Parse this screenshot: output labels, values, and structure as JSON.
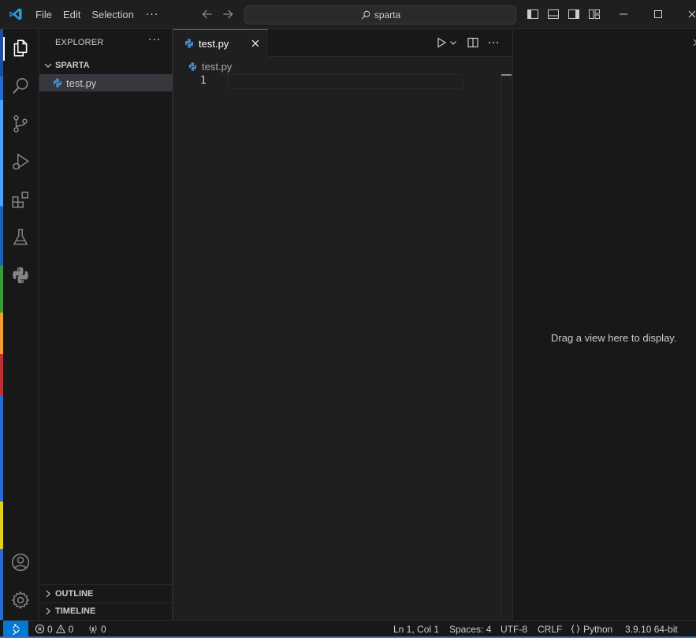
{
  "titlebar": {
    "menu": [
      "File",
      "Edit",
      "Selection"
    ],
    "more": "···",
    "search_text": "sparta"
  },
  "sidebar": {
    "title": "EXPLORER",
    "more": "···",
    "folder": "SPARTA",
    "files": [
      "test.py"
    ],
    "outline": "OUTLINE",
    "timeline": "TIMELINE"
  },
  "editor": {
    "tab_label": "test.py",
    "breadcrumb": "test.py",
    "line_number": "1"
  },
  "aux_panel": {
    "message": "Drag a view here to display."
  },
  "statusbar": {
    "errors": "0",
    "warnings": "0",
    "ports": "0",
    "position": "Ln 1, Col 1",
    "spaces": "Spaces: 4",
    "encoding": "UTF-8",
    "eol": "CRLF",
    "language": "Python",
    "interpreter": "3.9.10 64-bit"
  },
  "colors": {
    "accent": "#0078d4",
    "background": "#1f1f1f",
    "sidebar": "#181818",
    "selection": "#37373d",
    "python_icon": "#4a8fd1"
  },
  "icons": [
    "vscode-logo-icon",
    "arrow-left-icon",
    "arrow-right-icon",
    "search-icon",
    "toggle-sidebar-icon",
    "toggle-panel-icon",
    "toggle-secondary-sidebar-icon",
    "customize-layout-icon",
    "minimize-icon",
    "maximize-icon",
    "close-icon",
    "files-icon",
    "search-icon",
    "source-control-icon",
    "run-debug-icon",
    "extensions-icon",
    "testing-icon",
    "python-icon",
    "account-icon",
    "settings-gear-icon",
    "chevron-down-icon",
    "chevron-right-icon",
    "run-icon",
    "split-editor-icon",
    "remote-icon",
    "error-icon",
    "warning-icon",
    "ports-icon",
    "braces-icon"
  ]
}
